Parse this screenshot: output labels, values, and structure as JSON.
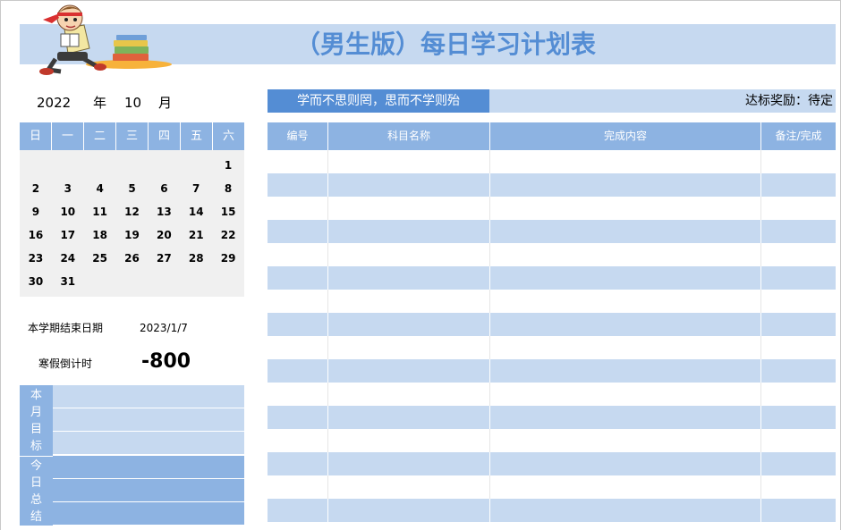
{
  "title": "（男生版）每日学习计划表",
  "date_selector": {
    "year": "2022",
    "year_unit": "年",
    "month": "10",
    "month_unit": "月"
  },
  "calendar": {
    "weekdays": [
      "日",
      "一",
      "二",
      "三",
      "四",
      "五",
      "六"
    ],
    "weeks": [
      [
        "",
        "",
        "",
        "",
        "",
        "",
        "1"
      ],
      [
        "2",
        "3",
        "4",
        "5",
        "6",
        "7",
        "8"
      ],
      [
        "9",
        "10",
        "11",
        "12",
        "13",
        "14",
        "15"
      ],
      [
        "16",
        "17",
        "18",
        "19",
        "20",
        "21",
        "22"
      ],
      [
        "23",
        "24",
        "25",
        "26",
        "27",
        "28",
        "29"
      ],
      [
        "30",
        "31",
        "",
        "",
        "",
        "",
        ""
      ]
    ]
  },
  "semester": {
    "end_label": "本学期结束日期",
    "end_date": "2023/1/7",
    "countdown_label": "寒假倒计时",
    "countdown_value": "-800"
  },
  "goals": {
    "month_goal_label": [
      "本",
      "月",
      "目",
      "标"
    ],
    "today_summary_label": [
      "今",
      "日",
      "总",
      "结"
    ]
  },
  "banner": {
    "motto": "学而不思则罔，思而不学则殆",
    "reward": "达标奖励：待定"
  },
  "table": {
    "headers": [
      "编号",
      "科目名称",
      "完成内容",
      "备注/完成"
    ],
    "row_count": 16
  },
  "colors": {
    "title_bg": "#c6d9f0",
    "title_text": "#548dd4",
    "header_bg": "#8db3e2",
    "motto_bg": "#548dd4",
    "alt_row": "#c6d9f0"
  },
  "icons": [
    "boy-reading-books-illustration"
  ]
}
